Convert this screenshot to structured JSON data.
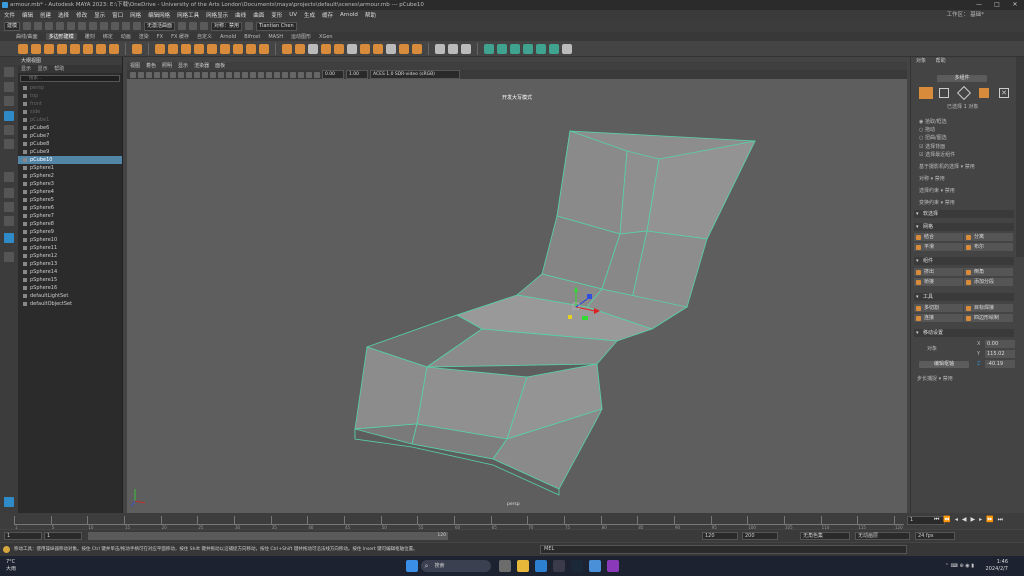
{
  "window": {
    "title": "armour.mb* - Autodesk MAYA 2023: E:\\下载\\OneDrive - University of the Arts London\\Documents\\maya\\projects\\default\\scenes\\armour.mb --- pCube10",
    "controls": [
      "—",
      "□",
      "✕"
    ]
  },
  "menubar": {
    "items": [
      "文件",
      "编辑",
      "创建",
      "选择",
      "修改",
      "显示",
      "窗口",
      "网格",
      "编辑网格",
      "网格工具",
      "网格显示",
      "曲线",
      "曲面",
      "变形",
      "UV",
      "生成",
      "缓存",
      "Arnold",
      "帮助"
    ],
    "workspace_label": "工作区：",
    "workspace_value": "基础*"
  },
  "statusline": {
    "mode": "建模",
    "no_live": "无激活曲面",
    "symmetry": "对称：禁用",
    "user": "Tiantian Chen"
  },
  "shelf_tabs": [
    "曲线/曲面",
    "多边形建模",
    "雕刻",
    "绑定",
    "动画",
    "渲染",
    "FX",
    "FX 缓存",
    "自定义",
    "Arnold",
    "Bifrost",
    "MASH",
    "运动图形",
    "XGen"
  ],
  "shelf_active_tab": "多边形建模",
  "outliner": {
    "title": "大纲视图",
    "menu": [
      "显示",
      "显示",
      "帮助"
    ],
    "search_placeholder": "搜索...",
    "items": [
      {
        "label": "persp",
        "dim": true
      },
      {
        "label": "top",
        "dim": true
      },
      {
        "label": "front",
        "dim": true
      },
      {
        "label": "side",
        "dim": true
      },
      {
        "label": "pCube1",
        "dim": true
      },
      {
        "label": "pCube6",
        "dim": false
      },
      {
        "label": "pCube7",
        "dim": false
      },
      {
        "label": "pCube8",
        "dim": false
      },
      {
        "label": "pCube9",
        "dim": false
      },
      {
        "label": "pCube10",
        "dim": false,
        "selected": true
      },
      {
        "label": "pSphere1",
        "dim": false
      },
      {
        "label": "pSphere2",
        "dim": false
      },
      {
        "label": "pSphere3",
        "dim": false
      },
      {
        "label": "pSphere4",
        "dim": false
      },
      {
        "label": "pSphere5",
        "dim": false
      },
      {
        "label": "pSphere6",
        "dim": false
      },
      {
        "label": "pSphere7",
        "dim": false
      },
      {
        "label": "pSphere8",
        "dim": false
      },
      {
        "label": "pSphere9",
        "dim": false
      },
      {
        "label": "pSphere10",
        "dim": false
      },
      {
        "label": "pSphere11",
        "dim": false
      },
      {
        "label": "pSphere12",
        "dim": false
      },
      {
        "label": "pSphere13",
        "dim": false
      },
      {
        "label": "pSphere14",
        "dim": false
      },
      {
        "label": "pSphere15",
        "dim": false
      },
      {
        "label": "pSphere16",
        "dim": false
      },
      {
        "label": "defaultLightSet",
        "dim": false
      },
      {
        "label": "defaultObjectSet",
        "dim": false
      }
    ]
  },
  "viewport": {
    "menu": [
      "视图",
      "着色",
      "照明",
      "显示",
      "渲染器",
      "面板"
    ],
    "field_a": "0.00",
    "field_b": "1.00",
    "color_mgmt": "ACES 1.0 SDR-video (sRGB)",
    "overlay_label": "开发大写模式",
    "camera_label": "persp"
  },
  "rightpanel": {
    "tabs": [
      "对象",
      "帮助"
    ],
    "multi_button": "多组件",
    "selected_count": "已选择 1 对象",
    "radio_options": [
      "拾取/框选",
      "拖动",
      "扭曲/图选"
    ],
    "check_options": [
      "选择背面",
      "选择最近组件"
    ],
    "soft_select_label": "基于摄影机的选择",
    "soft_select_value": "禁用",
    "symmetry_label": "对称",
    "symmetry_value": "禁用",
    "row1_label": "选择约束",
    "row1_value": "禁用",
    "row2_label": "变换约束",
    "row2_value": "禁用",
    "soft_section": "软选择",
    "mesh_section": "网格",
    "mesh_buttons": [
      "结合",
      "分离",
      "平滑",
      "布尔"
    ],
    "components_section": "组件",
    "comp_buttons": [
      "挤出",
      "倒角",
      "桥接",
      "添加分段"
    ],
    "tools_section": "工具",
    "tool_buttons": [
      "多切割",
      "目标焊接",
      "连接",
      "四边形绘制"
    ],
    "transform_section": "移动设置",
    "axis_label": "对象",
    "x_value": "0.00",
    "y_value": "115.02",
    "z_value": "-40.19",
    "reset_button": "编辑枢轴",
    "step_label": "步长捕捉",
    "step_value": "禁用"
  },
  "timeline": {
    "ticks": [
      "1",
      "5",
      "10",
      "15",
      "20",
      "25",
      "30",
      "35",
      "40",
      "45",
      "50",
      "55",
      "60",
      "65",
      "70",
      "75",
      "80",
      "85",
      "90",
      "95",
      "100",
      "105",
      "110",
      "115",
      "120"
    ],
    "current_frame": "1",
    "range_start": "1",
    "range_inner_start": "1",
    "range_end_label": "120",
    "range_end": "120",
    "anim_end": "200",
    "anim_layer": "无角色集",
    "anim_layer2": "无动画层",
    "fps": "24 fps"
  },
  "helpline": {
    "text": "移动工具：使用操纵器移动对象。按住 Ctrl 键并单击/拖动手柄可在对应平面移动，按住 Shift 键并拖动以沿捕捉方向移动，按住 Ctrl+Shift 键并拖动可沿法线方向移动。按住 Insert 键可编辑枢轴位置。",
    "mel_label": "MEL"
  },
  "taskbar": {
    "weather_temp": "7°C",
    "weather_desc": "大雨",
    "search_label": "搜索",
    "time": "1:46",
    "date": "2024/2/7"
  },
  "colors": {
    "viewport_bg": "#5e5e5e",
    "mesh_face": "#8a8a8a",
    "wire": "#57d3a6",
    "selection": "#5285a6",
    "accent": "#d88b3a"
  }
}
